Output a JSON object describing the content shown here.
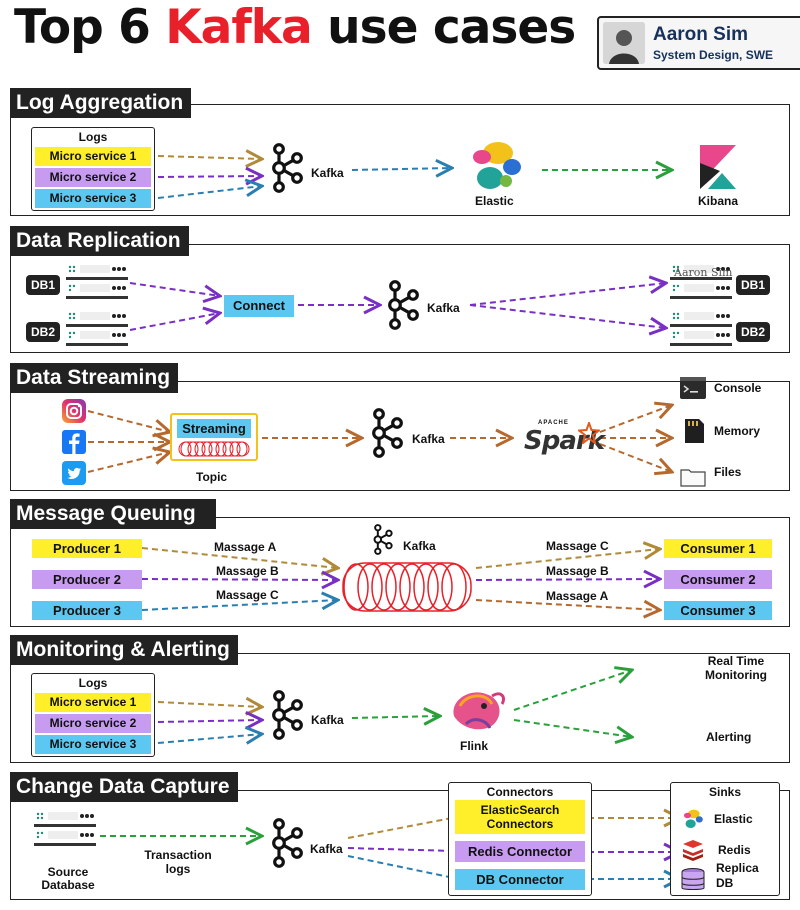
{
  "title": {
    "prefix": "Top 6",
    "highlight": "Kafka",
    "suffix": "use cases"
  },
  "author": {
    "name": "Aaron Sim",
    "role": "System Design, SWE"
  },
  "colors": {
    "yellow": "#ffef2a",
    "purple": "#c79cf0",
    "blue": "#5cc8f2",
    "accent": "#e8202a",
    "tab": "#222222"
  },
  "log_aggregation": {
    "heading": "Log Aggregation",
    "logs_title": "Logs",
    "services": [
      "Micro service 1",
      "Micro service 2",
      "Micro service 3"
    ],
    "kafka": "Kafka",
    "elastic": "Elastic",
    "kibana": "Kibana"
  },
  "data_replication": {
    "heading": "Data Replication",
    "db1": "DB1",
    "db2": "DB2",
    "connect": "Connect",
    "kafka": "Kafka",
    "watermark": "Aaron Sim",
    "db1_out": "DB1",
    "db2_out": "DB2"
  },
  "data_streaming": {
    "heading": "Data Streaming",
    "streaming": "Streaming",
    "topic": "Topic",
    "kafka": "Kafka",
    "spark_top": "APACHE",
    "spark": "Spark",
    "sinks": [
      "Console",
      "Memory",
      "Files"
    ]
  },
  "message_queuing": {
    "heading": "Message Queuing",
    "producers": [
      "Producer 1",
      "Producer 2",
      "Producer 3"
    ],
    "in_messages": [
      "Massage A",
      "Massage B",
      "Massage C"
    ],
    "kafka": "Kafka",
    "out_messages": [
      "Massage C",
      "Massage B",
      "Massage A"
    ],
    "consumers": [
      "Consumer 1",
      "Consumer 2",
      "Consumer 3"
    ]
  },
  "monitoring": {
    "heading": "Monitoring & Alerting",
    "logs_title": "Logs",
    "services": [
      "Micro service 1",
      "Micro service 2",
      "Micro service 3"
    ],
    "kafka": "Kafka",
    "flink": "Flink",
    "outputs": [
      "Real Time Monitoring",
      "Alerting"
    ]
  },
  "cdc": {
    "heading": "Change Data Capture",
    "source": "Source Database",
    "transaction_logs": "Transaction logs",
    "kafka": "Kafka",
    "connectors_title": "Connectors",
    "connectors": [
      "ElasticSearch Connectors",
      "Redis Connector",
      "DB Connector"
    ],
    "sinks_title": "Sinks",
    "sinks": [
      "Elastic",
      "Redis",
      "Replica DB"
    ]
  }
}
